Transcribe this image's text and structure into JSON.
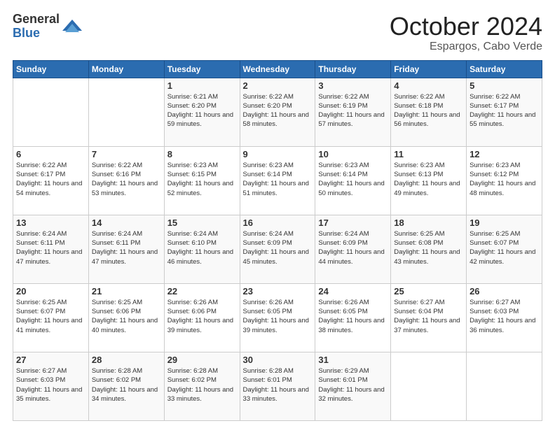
{
  "header": {
    "logo_general": "General",
    "logo_blue": "Blue",
    "month_title": "October 2024",
    "location": "Espargos, Cabo Verde"
  },
  "weekdays": [
    "Sunday",
    "Monday",
    "Tuesday",
    "Wednesday",
    "Thursday",
    "Friday",
    "Saturday"
  ],
  "weeks": [
    [
      {
        "day": "",
        "sunrise": "",
        "sunset": "",
        "daylight": ""
      },
      {
        "day": "",
        "sunrise": "",
        "sunset": "",
        "daylight": ""
      },
      {
        "day": "1",
        "sunrise": "Sunrise: 6:21 AM",
        "sunset": "Sunset: 6:20 PM",
        "daylight": "Daylight: 11 hours and 59 minutes."
      },
      {
        "day": "2",
        "sunrise": "Sunrise: 6:22 AM",
        "sunset": "Sunset: 6:20 PM",
        "daylight": "Daylight: 11 hours and 58 minutes."
      },
      {
        "day": "3",
        "sunrise": "Sunrise: 6:22 AM",
        "sunset": "Sunset: 6:19 PM",
        "daylight": "Daylight: 11 hours and 57 minutes."
      },
      {
        "day": "4",
        "sunrise": "Sunrise: 6:22 AM",
        "sunset": "Sunset: 6:18 PM",
        "daylight": "Daylight: 11 hours and 56 minutes."
      },
      {
        "day": "5",
        "sunrise": "Sunrise: 6:22 AM",
        "sunset": "Sunset: 6:17 PM",
        "daylight": "Daylight: 11 hours and 55 minutes."
      }
    ],
    [
      {
        "day": "6",
        "sunrise": "Sunrise: 6:22 AM",
        "sunset": "Sunset: 6:17 PM",
        "daylight": "Daylight: 11 hours and 54 minutes."
      },
      {
        "day": "7",
        "sunrise": "Sunrise: 6:22 AM",
        "sunset": "Sunset: 6:16 PM",
        "daylight": "Daylight: 11 hours and 53 minutes."
      },
      {
        "day": "8",
        "sunrise": "Sunrise: 6:23 AM",
        "sunset": "Sunset: 6:15 PM",
        "daylight": "Daylight: 11 hours and 52 minutes."
      },
      {
        "day": "9",
        "sunrise": "Sunrise: 6:23 AM",
        "sunset": "Sunset: 6:14 PM",
        "daylight": "Daylight: 11 hours and 51 minutes."
      },
      {
        "day": "10",
        "sunrise": "Sunrise: 6:23 AM",
        "sunset": "Sunset: 6:14 PM",
        "daylight": "Daylight: 11 hours and 50 minutes."
      },
      {
        "day": "11",
        "sunrise": "Sunrise: 6:23 AM",
        "sunset": "Sunset: 6:13 PM",
        "daylight": "Daylight: 11 hours and 49 minutes."
      },
      {
        "day": "12",
        "sunrise": "Sunrise: 6:23 AM",
        "sunset": "Sunset: 6:12 PM",
        "daylight": "Daylight: 11 hours and 48 minutes."
      }
    ],
    [
      {
        "day": "13",
        "sunrise": "Sunrise: 6:24 AM",
        "sunset": "Sunset: 6:11 PM",
        "daylight": "Daylight: 11 hours and 47 minutes."
      },
      {
        "day": "14",
        "sunrise": "Sunrise: 6:24 AM",
        "sunset": "Sunset: 6:11 PM",
        "daylight": "Daylight: 11 hours and 47 minutes."
      },
      {
        "day": "15",
        "sunrise": "Sunrise: 6:24 AM",
        "sunset": "Sunset: 6:10 PM",
        "daylight": "Daylight: 11 hours and 46 minutes."
      },
      {
        "day": "16",
        "sunrise": "Sunrise: 6:24 AM",
        "sunset": "Sunset: 6:09 PM",
        "daylight": "Daylight: 11 hours and 45 minutes."
      },
      {
        "day": "17",
        "sunrise": "Sunrise: 6:24 AM",
        "sunset": "Sunset: 6:09 PM",
        "daylight": "Daylight: 11 hours and 44 minutes."
      },
      {
        "day": "18",
        "sunrise": "Sunrise: 6:25 AM",
        "sunset": "Sunset: 6:08 PM",
        "daylight": "Daylight: 11 hours and 43 minutes."
      },
      {
        "day": "19",
        "sunrise": "Sunrise: 6:25 AM",
        "sunset": "Sunset: 6:07 PM",
        "daylight": "Daylight: 11 hours and 42 minutes."
      }
    ],
    [
      {
        "day": "20",
        "sunrise": "Sunrise: 6:25 AM",
        "sunset": "Sunset: 6:07 PM",
        "daylight": "Daylight: 11 hours and 41 minutes."
      },
      {
        "day": "21",
        "sunrise": "Sunrise: 6:25 AM",
        "sunset": "Sunset: 6:06 PM",
        "daylight": "Daylight: 11 hours and 40 minutes."
      },
      {
        "day": "22",
        "sunrise": "Sunrise: 6:26 AM",
        "sunset": "Sunset: 6:06 PM",
        "daylight": "Daylight: 11 hours and 39 minutes."
      },
      {
        "day": "23",
        "sunrise": "Sunrise: 6:26 AM",
        "sunset": "Sunset: 6:05 PM",
        "daylight": "Daylight: 11 hours and 39 minutes."
      },
      {
        "day": "24",
        "sunrise": "Sunrise: 6:26 AM",
        "sunset": "Sunset: 6:05 PM",
        "daylight": "Daylight: 11 hours and 38 minutes."
      },
      {
        "day": "25",
        "sunrise": "Sunrise: 6:27 AM",
        "sunset": "Sunset: 6:04 PM",
        "daylight": "Daylight: 11 hours and 37 minutes."
      },
      {
        "day": "26",
        "sunrise": "Sunrise: 6:27 AM",
        "sunset": "Sunset: 6:03 PM",
        "daylight": "Daylight: 11 hours and 36 minutes."
      }
    ],
    [
      {
        "day": "27",
        "sunrise": "Sunrise: 6:27 AM",
        "sunset": "Sunset: 6:03 PM",
        "daylight": "Daylight: 11 hours and 35 minutes."
      },
      {
        "day": "28",
        "sunrise": "Sunrise: 6:28 AM",
        "sunset": "Sunset: 6:02 PM",
        "daylight": "Daylight: 11 hours and 34 minutes."
      },
      {
        "day": "29",
        "sunrise": "Sunrise: 6:28 AM",
        "sunset": "Sunset: 6:02 PM",
        "daylight": "Daylight: 11 hours and 33 minutes."
      },
      {
        "day": "30",
        "sunrise": "Sunrise: 6:28 AM",
        "sunset": "Sunset: 6:01 PM",
        "daylight": "Daylight: 11 hours and 33 minutes."
      },
      {
        "day": "31",
        "sunrise": "Sunrise: 6:29 AM",
        "sunset": "Sunset: 6:01 PM",
        "daylight": "Daylight: 11 hours and 32 minutes."
      },
      {
        "day": "",
        "sunrise": "",
        "sunset": "",
        "daylight": ""
      },
      {
        "day": "",
        "sunrise": "",
        "sunset": "",
        "daylight": ""
      }
    ]
  ]
}
